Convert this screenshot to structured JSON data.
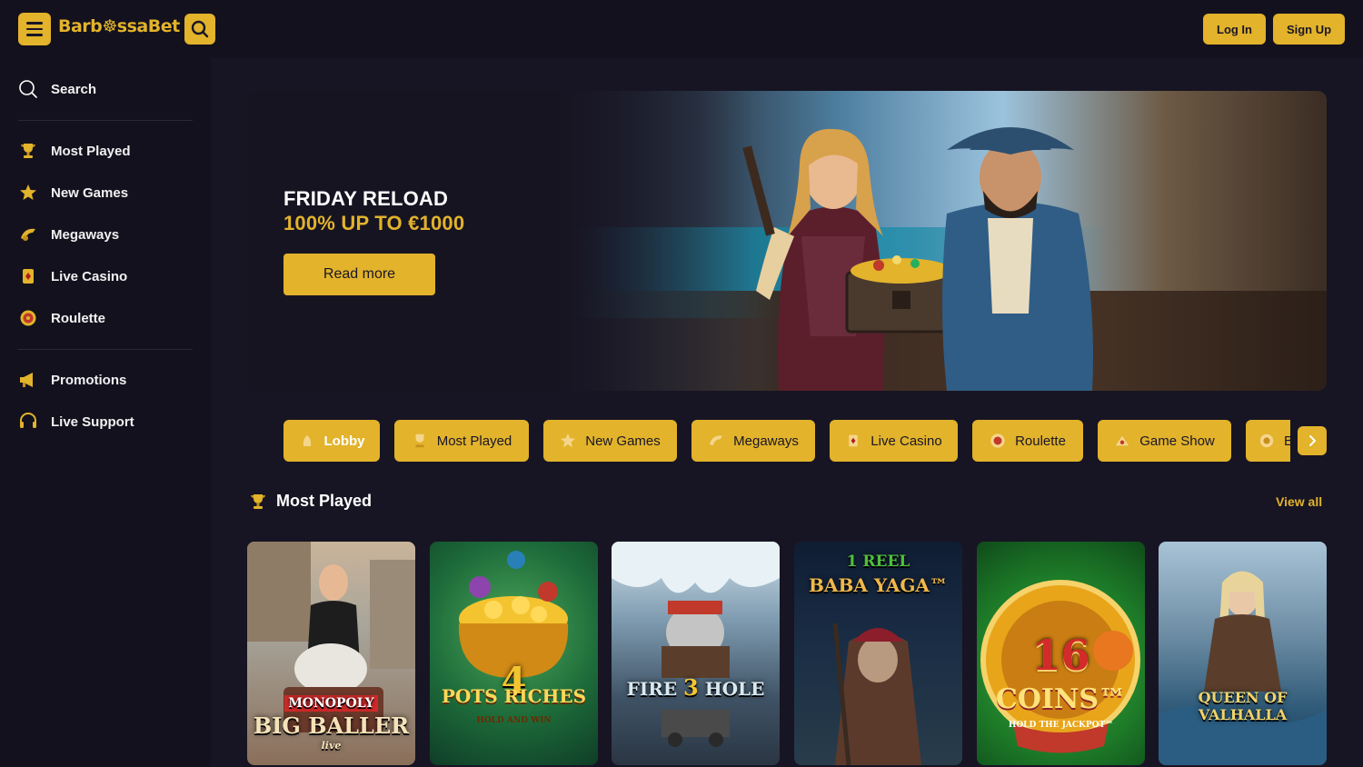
{
  "header": {
    "logo_text": "Barb☸ssaBet",
    "login_label": "Log In",
    "signup_label": "Sign Up",
    "menu_icon": "hamburger-icon",
    "search_icon": "search-icon"
  },
  "sidebar": {
    "search_label": "Search",
    "items": [
      {
        "label": "Most Played",
        "icon": "trophy-icon"
      },
      {
        "label": "New Games",
        "icon": "star-icon"
      },
      {
        "label": "Megaways",
        "icon": "megaways-icon"
      },
      {
        "label": "Live Casino",
        "icon": "card-icon"
      },
      {
        "label": "Roulette",
        "icon": "roulette-icon"
      },
      {
        "label": "Promotions",
        "icon": "megaphone-icon"
      },
      {
        "label": "Live Support",
        "icon": "headset-icon"
      }
    ]
  },
  "banner": {
    "title": "FRIDAY RELOAD",
    "subtitle": "100% UP TO €1000",
    "button_label": "Read more"
  },
  "categories": [
    {
      "label": "Lobby",
      "icon": "lobby-icon",
      "active": true
    },
    {
      "label": "Most Played",
      "icon": "trophy-icon"
    },
    {
      "label": "New Games",
      "icon": "star-icon"
    },
    {
      "label": "Megaways",
      "icon": "megaways-icon"
    },
    {
      "label": "Live Casino",
      "icon": "card-icon"
    },
    {
      "label": "Roulette",
      "icon": "roulette-icon"
    },
    {
      "label": "Game Show",
      "icon": "game-show-icon"
    },
    {
      "label": "B",
      "icon": "bonus-icon"
    }
  ],
  "section": {
    "title": "Most Played",
    "view_all": "View all"
  },
  "games": [
    {
      "title_top": "MONOPOLY",
      "title_bottom": "BIG BALLER",
      "extra": "live"
    },
    {
      "title_top": "4",
      "title_bottom": "POTS RICHES",
      "extra": "HOLD AND WIN"
    },
    {
      "title_top": "FIRE",
      "title_bottom": "HOLE",
      "extra": "3"
    },
    {
      "title_top": "1 REEL",
      "title_bottom": "BABA YAGA™",
      "extra": ""
    },
    {
      "title_top": "16",
      "title_bottom": "COINS™",
      "extra": "HOLD THE JACKPOT™"
    },
    {
      "title_top": "",
      "title_bottom": "QUEEN OF VALHALLA",
      "extra": ""
    }
  ],
  "colors": {
    "accent": "#e2b32b",
    "background": "#171523",
    "panel": "#13111d"
  }
}
